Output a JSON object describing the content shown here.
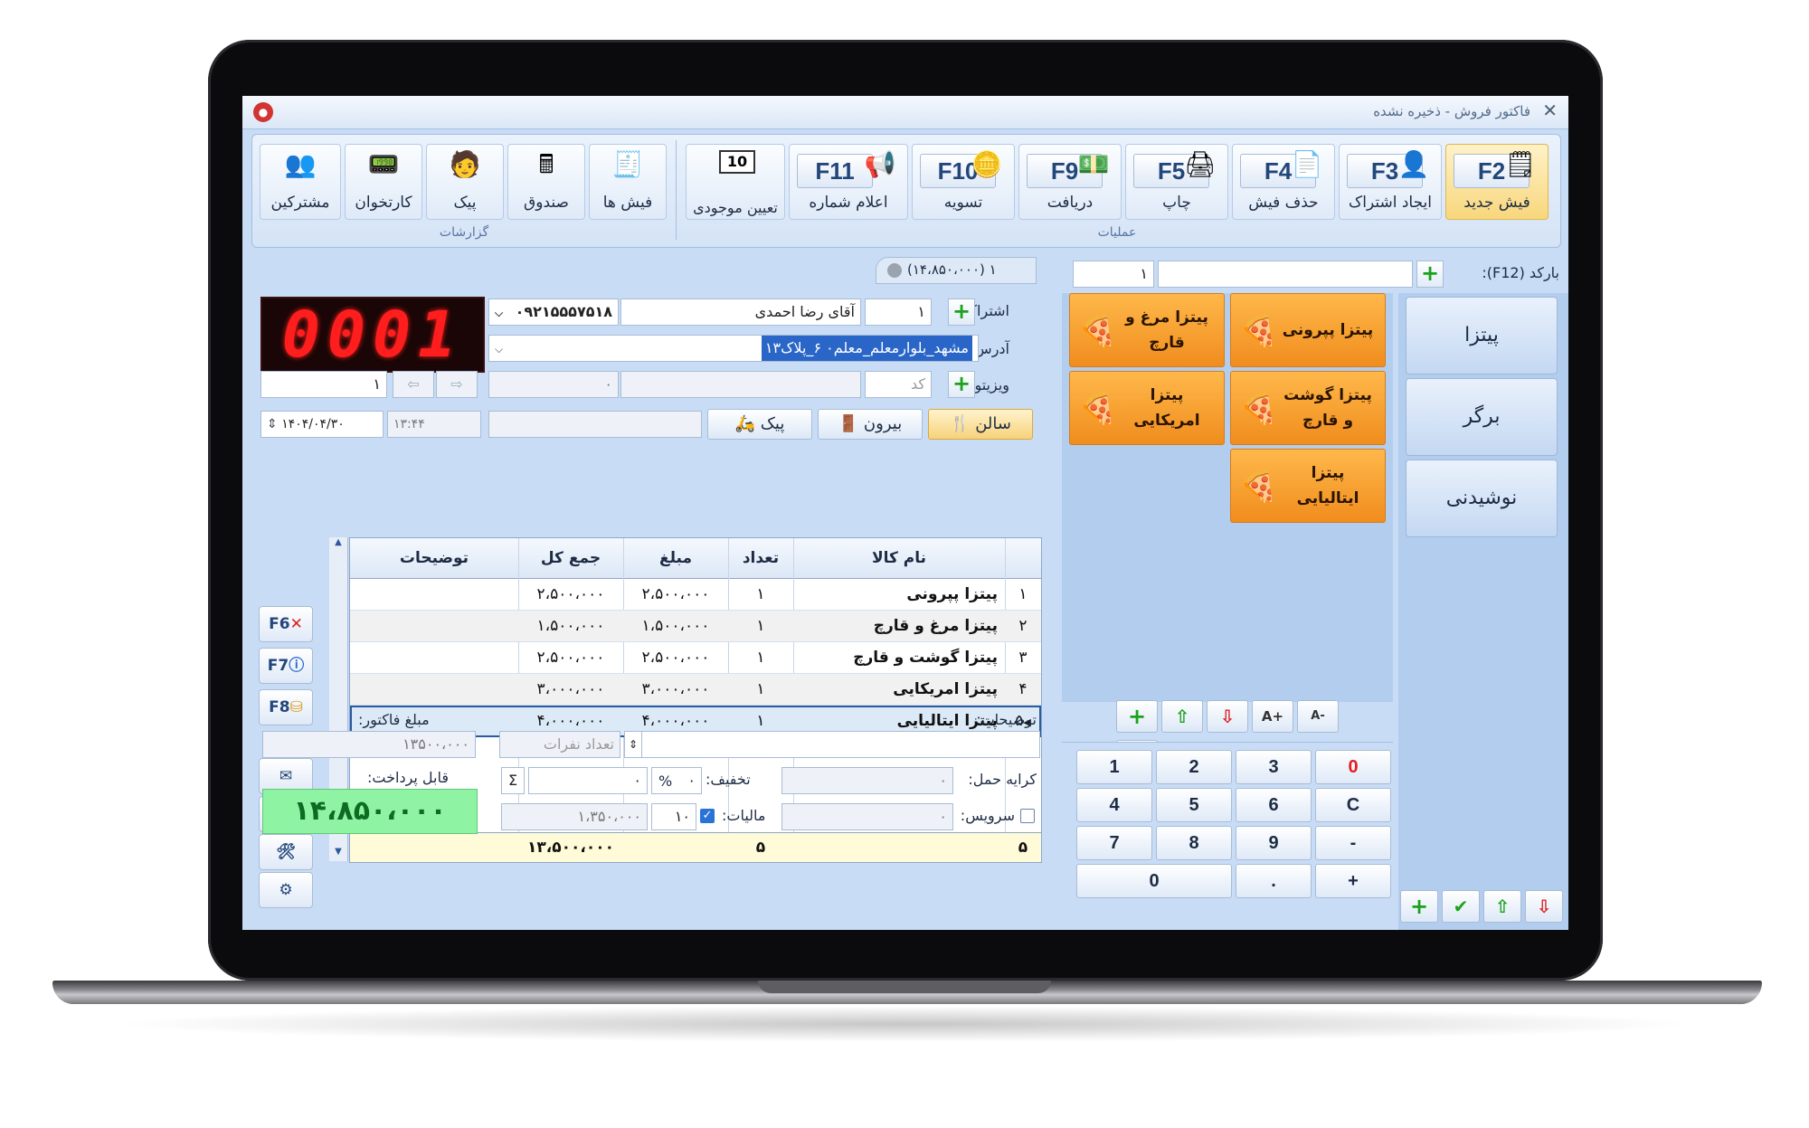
{
  "window": {
    "title": "فاکتور فروش - ذخیره نشده"
  },
  "ribbon": {
    "group_ops_label": "عملیات",
    "group_reports_label": "گزارشات",
    "ops": [
      {
        "key": "F2",
        "label": "فیش جدید",
        "icon": "new-receipt-icon"
      },
      {
        "key": "F3",
        "label": "ایجاد اشتراک",
        "icon": "add-user-icon"
      },
      {
        "key": "F4",
        "label": "حذف فیش",
        "icon": "delete-receipt-icon"
      },
      {
        "key": "F5",
        "label": "چاپ",
        "icon": "printer-icon"
      },
      {
        "key": "F9",
        "label": "دریافت",
        "icon": "cash-icon"
      },
      {
        "key": "F10",
        "label": "تسویه",
        "icon": "coins-icon"
      },
      {
        "key": "F11",
        "label": "اعلام شماره",
        "icon": "megaphone-icon"
      },
      {
        "key": "10",
        "label": "تعیین موجودی",
        "icon": "stock-counter-icon"
      }
    ],
    "reports": [
      {
        "label": "فیش ها",
        "icon": "receipts-icon"
      },
      {
        "label": "صندوق",
        "icon": "cash-register-icon"
      },
      {
        "label": "پیک",
        "icon": "courier-icon"
      },
      {
        "label": "کارتخوان",
        "icon": "card-reader-icon"
      },
      {
        "label": "مشترکین",
        "icon": "customers-icon"
      }
    ]
  },
  "header": {
    "receipt_summary": "۱ (۱۴،۸۵۰،۰۰۰)",
    "order_number_display": "0001",
    "barcode_label": "بارکد (F12):",
    "barcode_qty": "۱",
    "barcode_value": ""
  },
  "customer": {
    "subscription_label": "اشتراک:",
    "subscription_code": "۱",
    "customer_name": "آقای رضا احمدی",
    "phone": "۰۹۲۱۵۵۵۷۵۱۸",
    "address_label": "آدرس:",
    "address": "مشهد_بلوارمعلم_معلم۰ ۶_پلاک۱۳",
    "visitor_label": "ویزیتور:",
    "visitor_code_placeholder": "کد",
    "visitor_name": "",
    "visitor_value": "۰",
    "table_no": "۱",
    "date": "۱۴۰۴/۰۴/۳۰",
    "time": "۱۳:۴۴",
    "service_types": [
      {
        "label": "سالن",
        "icon": "dine-in-icon",
        "selected": true
      },
      {
        "label": "بیرون",
        "icon": "door-icon",
        "selected": false
      },
      {
        "label": "پیک",
        "icon": "courier-icon",
        "selected": false
      }
    ]
  },
  "table": {
    "columns": [
      "نام کالا",
      "تعداد",
      "مبلغ",
      "جمع کل",
      "توضیحات"
    ],
    "rows": [
      {
        "idx": "۱",
        "name": "پیتزا پپرونی",
        "qty": "۱",
        "price": "۲،۵۰۰،۰۰۰",
        "total": "۲،۵۰۰،۰۰۰",
        "desc": ""
      },
      {
        "idx": "۲",
        "name": "پیتزا مرغ و قارچ",
        "qty": "۱",
        "price": "۱،۵۰۰،۰۰۰",
        "total": "۱،۵۰۰،۰۰۰",
        "desc": ""
      },
      {
        "idx": "۳",
        "name": "پیتزا گوشت و قارچ",
        "qty": "۱",
        "price": "۲،۵۰۰،۰۰۰",
        "total": "۲،۵۰۰،۰۰۰",
        "desc": ""
      },
      {
        "idx": "۴",
        "name": "پیتزا امریکایی",
        "qty": "۱",
        "price": "۳،۰۰۰،۰۰۰",
        "total": "۳،۰۰۰،۰۰۰",
        "desc": ""
      },
      {
        "idx": "۵",
        "name": "پیتزا ایتالیایی",
        "qty": "۱",
        "price": "۴،۰۰۰،۰۰۰",
        "total": "۴،۰۰۰،۰۰۰",
        "desc": ""
      }
    ],
    "footer": {
      "count": "۵",
      "qty": "۵",
      "total": "۱۳،۵۰۰،۰۰۰"
    }
  },
  "side_tools": [
    "F6",
    "F7",
    "F8"
  ],
  "totals": {
    "invoice_amount_label": "مبلغ فاکتور:",
    "invoice_amount": "۱۳۵۰۰،۰۰۰",
    "payable_label": "قابل پرداخت:",
    "payable": "۱۴،۸۵۰،۰۰۰",
    "description_label": "توضیحات:",
    "people_count_placeholder": "تعداد نفرات",
    "shipping_label": "کرایه حمل:",
    "shipping_value": "۰",
    "discount_label": "تخفیف:",
    "discount_percent": "۰",
    "discount_amount": "۰",
    "tax_label": "مالیات:",
    "tax_percent": "۱۰",
    "tax_amount": "۱،۳۵۰،۰۰۰",
    "service_label": "سرویس:",
    "service_value": "۰",
    "percent_sign": "%",
    "sigma": "Σ"
  },
  "menu": {
    "categories": [
      "پیتزا",
      "برگر",
      "نوشیدنی"
    ],
    "products": [
      {
        "name": "پیتزا پپرونی",
        "icon": "pizza-icon"
      },
      {
        "name": "پیتزا مرغ و قارچ",
        "icon": "pizza-slice-icon"
      },
      {
        "name": "پیتزا گوشت و قارچ",
        "icon": "pizza-icon"
      },
      {
        "name": "پیتزا امریکایی",
        "icon": "pizza-icon"
      },
      {
        "name": "پیتزا ایتالیایی",
        "icon": "pizza-icon"
      }
    ],
    "font_tools": [
      "A+",
      "A-"
    ]
  },
  "keypad": {
    "rows": [
      [
        "0",
        "3",
        "2",
        "1"
      ],
      [
        "C",
        "6",
        "5",
        "4"
      ],
      [
        "-",
        "9",
        "8",
        "7"
      ]
    ],
    "last_row": {
      "plus": "+",
      "dot": ".",
      "zero": "0"
    }
  },
  "colors": {
    "accent": "#f29320",
    "digital": "#ff1d1d",
    "payable_bg": "#8ef3a2"
  }
}
